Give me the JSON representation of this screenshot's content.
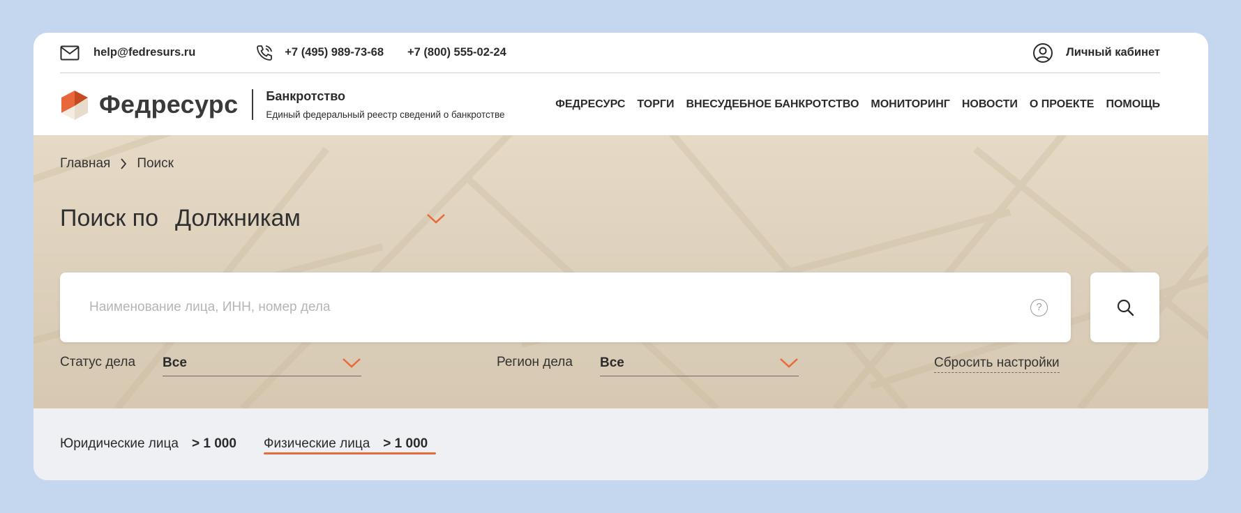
{
  "topbar": {
    "email": "help@fedresurs.ru",
    "phone1": "+7 (495) 989-73-68",
    "phone2": "+7 (800) 555-02-24",
    "account_label": "Личный кабинет",
    "icons": {
      "mail": "mail-icon",
      "phone": "phone-icon",
      "account": "user-icon"
    }
  },
  "header": {
    "logo_text": "Федресурс",
    "section_title": "Банкротство",
    "section_desc": "Единый федеральный реестр сведений о банкротстве",
    "nav": [
      "ФЕДРЕСУРС",
      "ТОРГИ",
      "ВНЕСУДЕБНОЕ БАНКРОТСТВО",
      "МОНИТОРИНГ",
      "НОВОСТИ",
      "О ПРОЕКТЕ",
      "ПОМОЩЬ"
    ]
  },
  "breadcrumb": {
    "home": "Главная",
    "current": "Поиск"
  },
  "search": {
    "title_prefix": "Поиск по",
    "entity_selected": "Должникам",
    "placeholder": "Наименование лица, ИНН, номер дела",
    "help_glyph": "?"
  },
  "filters": {
    "status_label": "Статус дела",
    "status_value": "Все",
    "region_label": "Регион дела",
    "region_value": "Все",
    "reset_label": "Сбросить настройки"
  },
  "tabs": [
    {
      "label": "Юридические лица",
      "count": "> 1 000",
      "active": false
    },
    {
      "label": "Физические лица",
      "count": "> 1 000",
      "active": true
    }
  ],
  "colors": {
    "accent": "#e86a3a",
    "page_bg": "#c5d6ef",
    "hero_bg": "#e0d4bf",
    "tabs_bg": "#eef0f3"
  }
}
